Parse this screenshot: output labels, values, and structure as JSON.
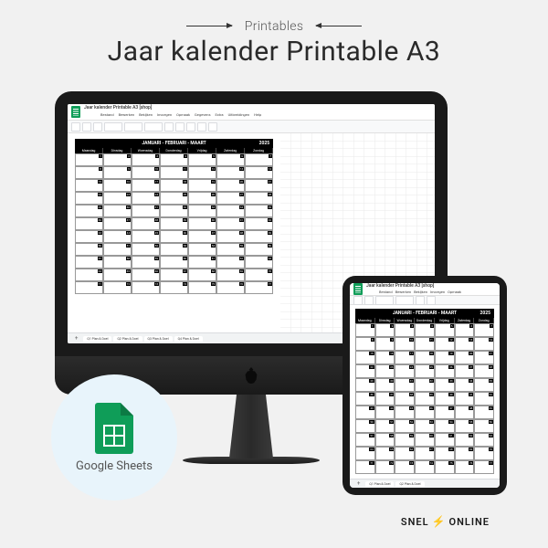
{
  "header": {
    "category": "Printables",
    "title": "Jaar kalender Printable A3"
  },
  "document": {
    "name": "Jaar kalender Printable A3 [shop]",
    "menus": [
      "Bestand",
      "Bewerken",
      "Bekijken",
      "Invoegen",
      "Opmaak",
      "Gegevens",
      "Extra",
      "Uitbreidingen",
      "Help"
    ]
  },
  "calendar": {
    "months_label": "JANUARI - FEBRUARI - MAART",
    "year": "2025",
    "days": [
      "Maandag",
      "Dinsdag",
      "Woensdag",
      "Donderdag",
      "Vrijdag",
      "Zaterdag",
      "Zondag"
    ],
    "rows": 11
  },
  "sheet_tabs": {
    "plus": "+",
    "items": [
      "Q1 Plan & Doel",
      "Q2 Plan & Doel",
      "Q3 Plan & Doel",
      "Q4 Plan & Doel"
    ]
  },
  "ipad_tabs": {
    "items": [
      "Q1 Plan & Doel",
      "Q2 Plan & Doel"
    ]
  },
  "badge": {
    "label": "Google Sheets"
  },
  "brand": {
    "name": "SNEL",
    "suffix": "ONLINE"
  }
}
